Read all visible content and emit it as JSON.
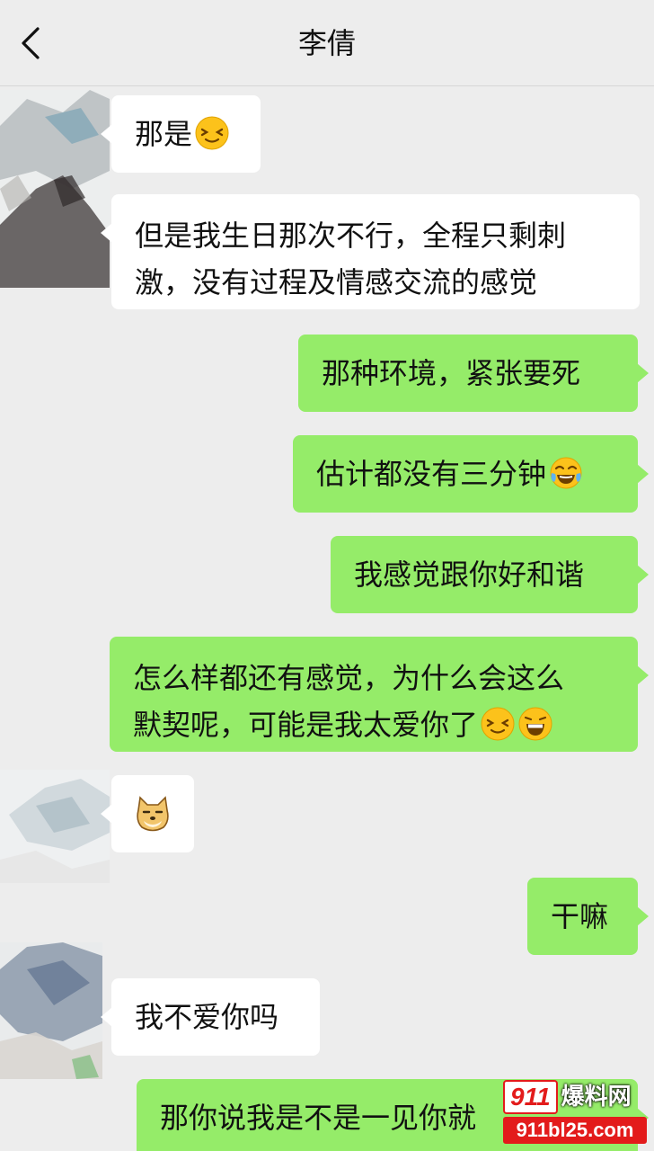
{
  "header": {
    "title": "李倩"
  },
  "messages": [
    {
      "side": "left",
      "lines": [
        "那是"
      ],
      "emoji": "squint-smile"
    },
    {
      "side": "left",
      "lines": [
        "但是我生日那次不行，全程只剩刺",
        "激，没有过程及情感交流的感觉"
      ]
    },
    {
      "side": "right",
      "lines": [
        "那种环境，紧张要死"
      ]
    },
    {
      "side": "right",
      "lines": [
        "估计都没有三分钟"
      ],
      "emoji": "tears-of-joy"
    },
    {
      "side": "right",
      "lines": [
        "我感觉跟你好和谐"
      ]
    },
    {
      "side": "right",
      "lines": [
        "怎么样都还有感觉，为什么会这么",
        "默契呢，可能是我太爱你了"
      ],
      "emoji": "squint-smile, grin"
    },
    {
      "side": "left",
      "lines": [],
      "emoji": "doge"
    },
    {
      "side": "right",
      "lines": [
        "干嘛"
      ]
    },
    {
      "side": "left",
      "lines": [
        "我不爱你吗"
      ]
    },
    {
      "side": "right",
      "lines": [
        "那你说我是不是一见你就"
      ]
    }
  ],
  "watermark": {
    "brand_num": "911",
    "brand_text": "爆料网",
    "domain": "911bl25.com"
  },
  "colors": {
    "background": "#ededed",
    "bubble_self": "#95ec69",
    "bubble_other": "#ffffff",
    "text": "#111111"
  }
}
